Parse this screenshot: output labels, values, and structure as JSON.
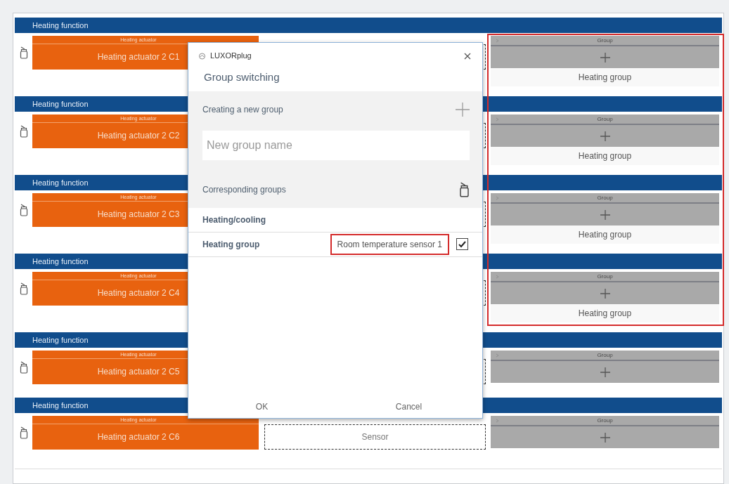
{
  "rows": [
    {
      "title": "Heating function",
      "actuator_type": "Heating actuator",
      "actuator": "Heating actuator 2 C1",
      "group": {
        "header": "Group",
        "name": "Heating group"
      },
      "highlighted": true
    },
    {
      "title": "Heating function",
      "actuator_type": "Heating actuator",
      "actuator": "Heating actuator 2 C2",
      "group": {
        "header": "Group",
        "name": "Heating group"
      },
      "highlighted": true
    },
    {
      "title": "Heating function",
      "actuator_type": "Heating actuator",
      "actuator": "Heating actuator 2 C3",
      "group": {
        "header": "Group",
        "name": "Heating group"
      },
      "highlighted": true
    },
    {
      "title": "Heating function",
      "actuator_type": "Heating actuator",
      "actuator": "Heating actuator 2 C4",
      "group": {
        "header": "Group",
        "name": "Heating group"
      },
      "highlighted": true
    },
    {
      "title": "Heating function",
      "actuator_type": "Heating actuator",
      "actuator": "Heating actuator 2 C5",
      "group": {
        "header": "Group"
      },
      "highlighted": false
    },
    {
      "title": "Heating function",
      "actuator_type": "Heating actuator",
      "actuator": "Heating actuator 2 C6",
      "sensor": "Sensor",
      "group": {
        "header": "Group"
      },
      "highlighted": false
    }
  ],
  "dialog": {
    "app_title": "LUXORplug",
    "heading": "Group switching",
    "new_group": {
      "label": "Creating a new group",
      "placeholder": "New group name"
    },
    "corresponding_label": "Corresponding groups",
    "group_categories": [
      {
        "name": "Heating/cooling",
        "groups": [
          {
            "name": "Heating group",
            "sensor": "Room temperature sensor 1",
            "highlighted": true,
            "checked": true
          }
        ]
      }
    ],
    "buttons": [
      "OK",
      "Cancel"
    ]
  }
}
